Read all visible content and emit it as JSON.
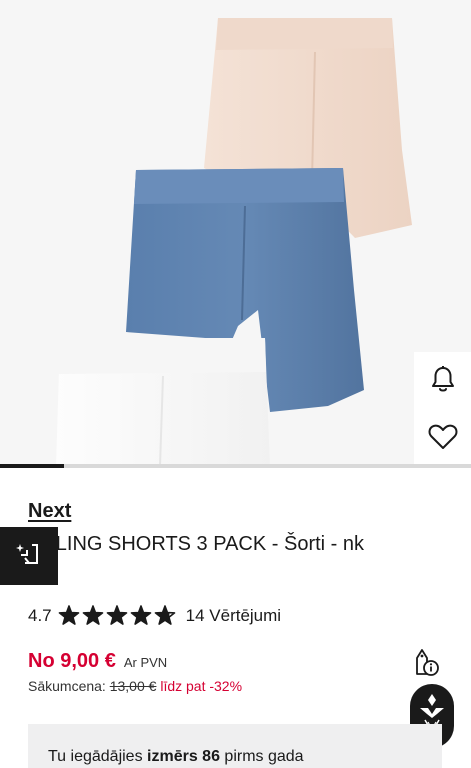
{
  "product": {
    "brand": "Next",
    "title": "YCLING SHORTS 3 PACK - Šorti - nk"
  },
  "rating": {
    "score": "4.7",
    "stars_value": 4.7,
    "stars_max": 5,
    "count_label": "14 Vērtējumi"
  },
  "price": {
    "current": "No 9,00 €",
    "vat_label": "Ar PVN",
    "original_label": "Sākumcena:",
    "original_value": "13,00 €",
    "discount_label": "līdz pat -32%"
  },
  "size_banner": {
    "prefix": "Tu iegādājies",
    "highlight": "izmērs 86",
    "suffix": "pirms gada"
  },
  "carousel": {
    "progress": 0.135
  },
  "icons": {
    "notify": "bell-icon",
    "wishlist": "heart-icon",
    "compare": "compare-icon",
    "price_info": "price-tag-info-icon",
    "assistant": "assistant-logo-icon"
  },
  "colors": {
    "accent_red": "#d50032",
    "dark": "#1a1a1a",
    "banner_bg": "#efeff0",
    "short_pink": "#f2ddd0",
    "short_blue": "#5f83b0",
    "short_white": "#fafafa"
  }
}
